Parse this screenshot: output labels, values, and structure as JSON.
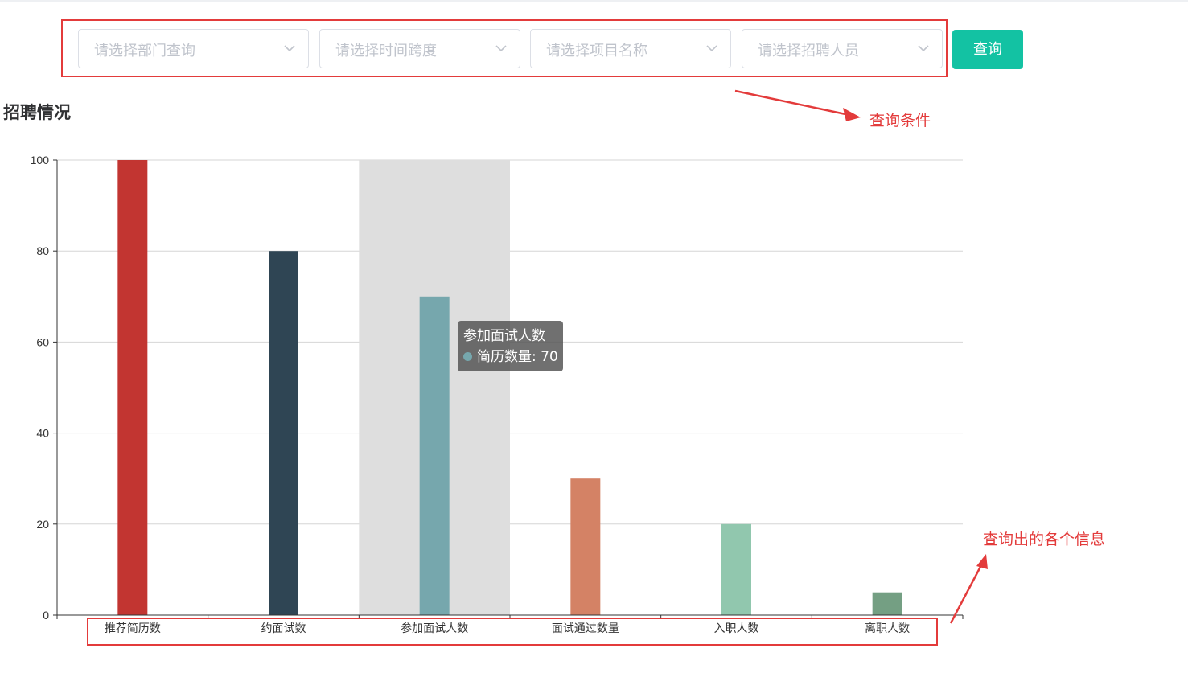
{
  "filters": [
    {
      "placeholder": "请选择部门查询"
    },
    {
      "placeholder": "请选择时间跨度"
    },
    {
      "placeholder": "请选择项目名称"
    },
    {
      "placeholder": "请选择招聘人员"
    }
  ],
  "query_button": {
    "label": "查询",
    "color": "#13c2a3"
  },
  "section_title": "招聘情况",
  "annotations": {
    "query_conditions": "查询条件",
    "query_results": "查询出的各个信息",
    "color": "#e33b3b"
  },
  "tooltip": {
    "title": "参加面试人数",
    "series_label": "简历数量",
    "value": "70",
    "dot_color": "#76a7ad"
  },
  "chart_data": {
    "type": "bar",
    "categories": [
      "推荐简历数",
      "约面试数",
      "参加面试人数",
      "面试通过数量",
      "入职人数",
      "离职人数"
    ],
    "series": [
      {
        "name": "简历数量",
        "values": [
          100,
          80,
          70,
          30,
          20,
          5
        ]
      }
    ],
    "colors": [
      "#c23531",
      "#2f4554",
      "#76a7ad",
      "#d48265",
      "#91c7ae",
      "#749f83"
    ],
    "ylim": [
      0,
      100
    ],
    "yticks": [
      0,
      20,
      40,
      60,
      80,
      100
    ],
    "highlighted_category": "参加面试人数",
    "grid": true
  }
}
